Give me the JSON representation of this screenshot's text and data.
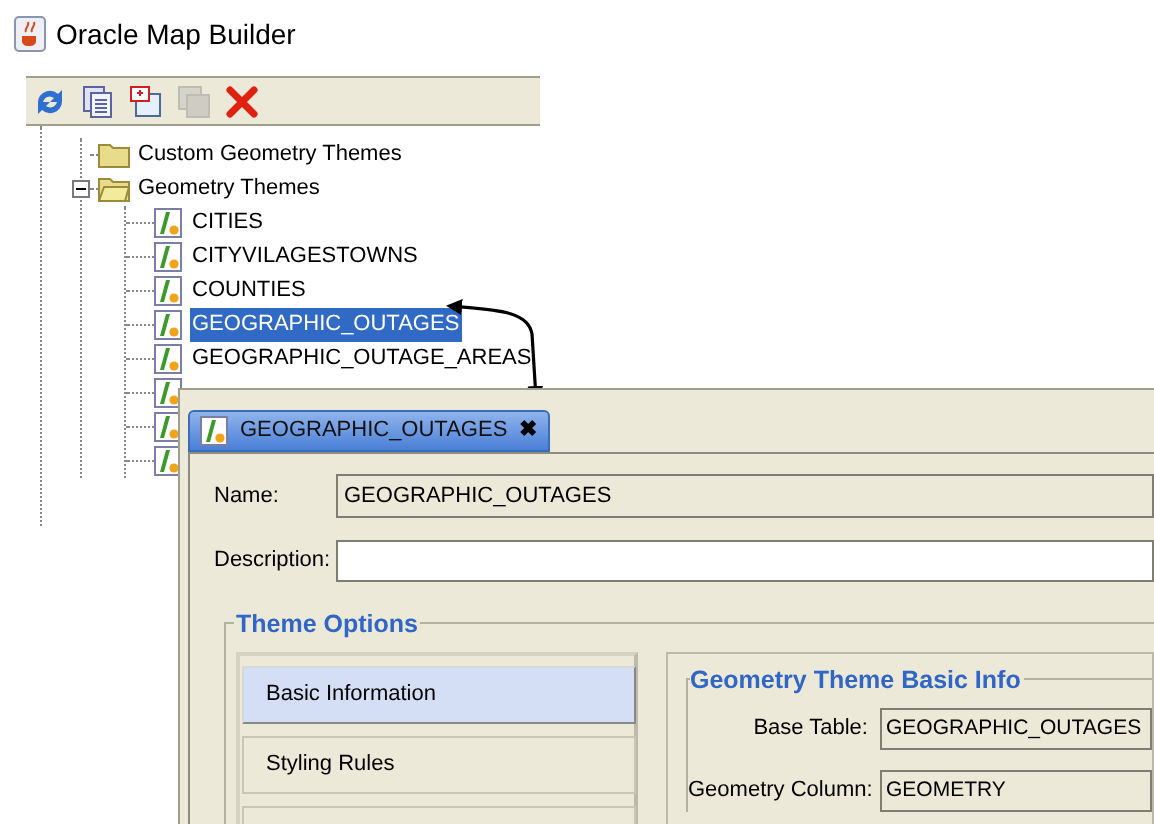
{
  "window": {
    "title": "Oracle Map Builder"
  },
  "toolbar": [
    {
      "kind": "refresh",
      "disabled": false
    },
    {
      "kind": "copy",
      "disabled": false
    },
    {
      "kind": "new",
      "disabled": false
    },
    {
      "kind": "code",
      "disabled": true
    },
    {
      "kind": "delete",
      "disabled": false
    }
  ],
  "tree": [
    {
      "kind": "folder",
      "label": "Custom Geometry Themes"
    },
    {
      "kind": "folder",
      "label": "Geometry Themes",
      "expanded": true,
      "children": [
        {
          "kind": "theme",
          "label": "CITIES",
          "selected": false
        },
        {
          "kind": "theme",
          "label": "CITYVILAGESTOWNS",
          "selected": false
        },
        {
          "kind": "theme",
          "label": "COUNTIES",
          "selected": false
        },
        {
          "kind": "theme",
          "label": "GEOGRAPHIC_OUTAGES",
          "selected": true
        },
        {
          "kind": "theme",
          "label": "GEOGRAPHIC_OUTAGE_AREAS",
          "selected": false
        },
        {
          "kind": "theme"
        },
        {
          "kind": "theme"
        },
        {
          "kind": "theme"
        }
      ]
    }
  ],
  "editor": {
    "tab": {
      "label": "GEOGRAPHIC_OUTAGES",
      "close": "✖"
    },
    "name": {
      "label": "Name:",
      "value": "GEOGRAPHIC_OUTAGES"
    },
    "description": {
      "label": "Description:"
    },
    "theme_options": {
      "title": "Theme Options",
      "sections": [
        {
          "label": "Basic Information",
          "selected": true
        },
        {
          "label": "Styling Rules",
          "selected": false
        },
        {
          "selected": false
        }
      ],
      "basic_info": {
        "title": "Geometry Theme Basic Info",
        "fields": [
          {
            "label": "Base Table:",
            "value": "GEOGRAPHIC_OUTAGES"
          },
          {
            "label": "Geometry Column:",
            "value": "GEOMETRY"
          }
        ]
      }
    }
  }
}
